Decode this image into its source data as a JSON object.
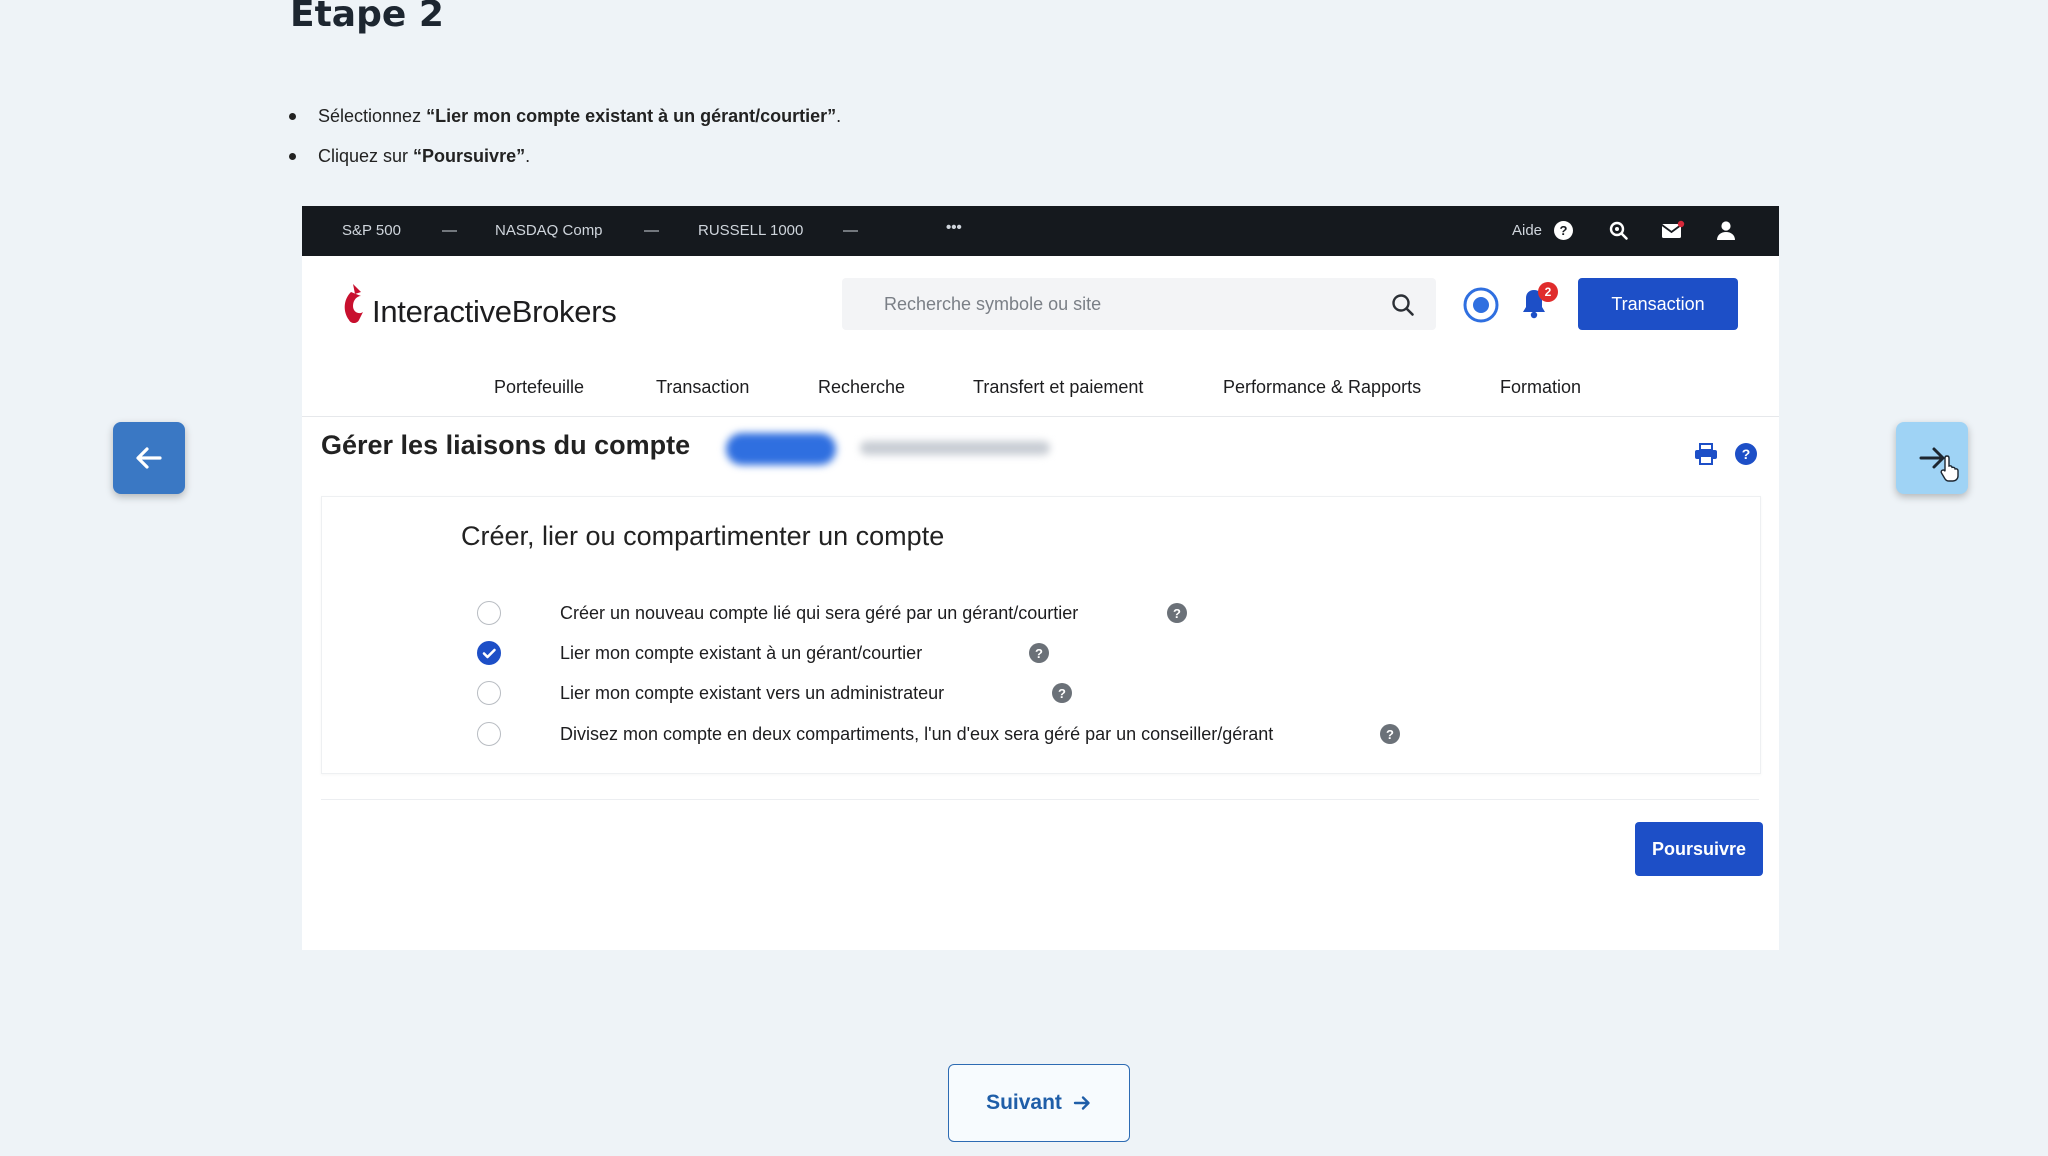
{
  "tutorial": {
    "step_title": "Etape 2",
    "instructions": [
      {
        "prefix": "Sélectionnez ",
        "bold": "“Lier mon compte existant à un gérant/courtier”",
        "suffix": "."
      },
      {
        "prefix": "Cliquez sur ",
        "bold": "“Poursuivre”",
        "suffix": "."
      }
    ],
    "next_button": "Suivant"
  },
  "ticker": {
    "items": [
      {
        "name": "S&P 500",
        "value": "—"
      },
      {
        "name": "NASDAQ Comp",
        "value": "—"
      },
      {
        "name": "RUSSELL 1000",
        "value": "—"
      }
    ],
    "more": "•••",
    "help_label": "Aide"
  },
  "brand": {
    "logo_light": "Interactive",
    "logo_bold": "Brokers",
    "accent": "#c8102e"
  },
  "search": {
    "placeholder": "Recherche symbole ou site"
  },
  "notifications": {
    "count": "2"
  },
  "header": {
    "trade_button": "Transaction"
  },
  "nav": {
    "items": [
      "Portefeuille",
      "Transaction",
      "Recherche",
      "Transfert et paiement",
      "Performance & Rapports",
      "Formation"
    ]
  },
  "page": {
    "title": "Gérer les liaisons du compte"
  },
  "card": {
    "title": "Créer, lier ou compartimenter un compte",
    "options": [
      {
        "label": "Créer un nouveau compte lié qui sera géré par un gérant/courtier",
        "checked": false
      },
      {
        "label": "Lier mon compte existant à un gérant/courtier",
        "checked": true
      },
      {
        "label": "Lier mon compte existant vers un administrateur",
        "checked": false
      },
      {
        "label": "Divisez mon compte en deux compartiments, l'un d'eux sera géré par un conseiller/gérant",
        "checked": false
      }
    ],
    "continue_button": "Poursuivre"
  },
  "colors": {
    "primary": "#1d4fc7",
    "ticker_bg": "#15191e",
    "page_bg": "#eef3f7"
  }
}
